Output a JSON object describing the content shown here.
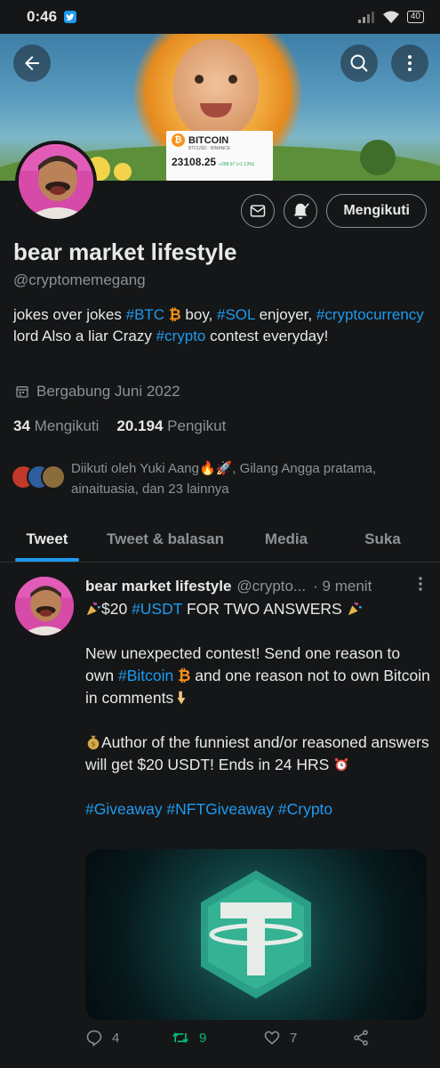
{
  "status_bar": {
    "time": "0:46",
    "battery": "40"
  },
  "banner": {
    "ticker_title": "BITCOIN",
    "ticker_pair": "BTCUSD",
    "ticker_exchange": "BINANCE",
    "ticker_price": "23108.25",
    "ticker_change": "+258.97 (+1.13%)"
  },
  "profile": {
    "follow_button": "Mengikuti",
    "name": "bear market lifestyle",
    "handle": "@cryptomemegang",
    "bio_parts": {
      "p1": "jokes over jokes ",
      "tag1": "#BTC",
      "btc_symbol": "₿",
      "p2": "  boy, ",
      "tag2": "#SOL",
      "p3": " enjoyer, ",
      "tag3": "#cryptocurrency",
      "p4": " lord Also a liar  Crazy ",
      "tag4": "#crypto",
      "p5": " contest everyday!"
    },
    "joined": "Bergabung Juni 2022",
    "following_count": "34",
    "following_label": "Mengikuti",
    "followers_count": "20.194",
    "followers_label": "Pengikut",
    "followed_by": "Diikuti oleh Yuki Aang🔥🚀, Gilang Angga pratama, ainaituasia, dan 23 lainnya"
  },
  "tabs": [
    {
      "label": "Tweet",
      "active": true
    },
    {
      "label": "Tweet & balasan",
      "active": false
    },
    {
      "label": "Media",
      "active": false
    },
    {
      "label": "Suka",
      "active": false
    }
  ],
  "tweet": {
    "name": "bear market lifestyle",
    "handle": "@crypto...",
    "time": "· 9 menit",
    "line1_a": "$20 ",
    "line1_tag": "#USDT",
    "line1_b": " FOR TWO ANSWERS ",
    "para2_a": "New unexpected contest! Send one reason to own ",
    "para2_tag": "#Bitcoin",
    "para2_b": "  and one reason not to own Bitcoin in comments",
    "para3": "Author of the funniest and/or reasoned answers will get $20 USDT! Ends in 24 HRS",
    "tags": "#Giveaway #NFTGiveaway #Crypto",
    "reply_count": "4",
    "retweet_count": "9",
    "like_count": "7"
  },
  "colors": {
    "background": "#151617",
    "accent": "#1d9bf0",
    "retweet": "#00ba7c",
    "muted": "#8b9298",
    "bitcoin": "#f7931a"
  }
}
